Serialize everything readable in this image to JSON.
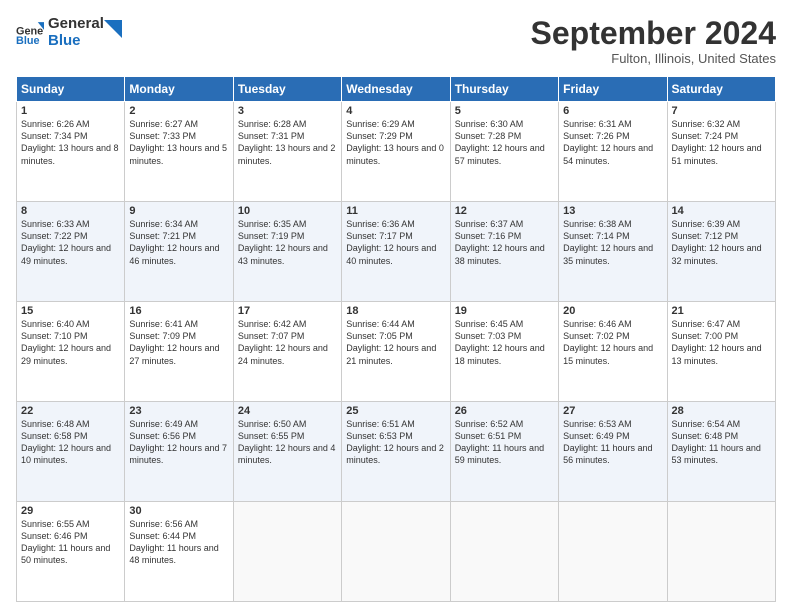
{
  "logo": {
    "line1": "General",
    "line2": "Blue"
  },
  "title": "September 2024",
  "location": "Fulton, Illinois, United States",
  "days_of_week": [
    "Sunday",
    "Monday",
    "Tuesday",
    "Wednesday",
    "Thursday",
    "Friday",
    "Saturday"
  ],
  "weeks": [
    [
      {
        "day": "1",
        "sunrise": "6:26 AM",
        "sunset": "7:34 PM",
        "daylight": "13 hours and 8 minutes."
      },
      {
        "day": "2",
        "sunrise": "6:27 AM",
        "sunset": "7:33 PM",
        "daylight": "13 hours and 5 minutes."
      },
      {
        "day": "3",
        "sunrise": "6:28 AM",
        "sunset": "7:31 PM",
        "daylight": "13 hours and 2 minutes."
      },
      {
        "day": "4",
        "sunrise": "6:29 AM",
        "sunset": "7:29 PM",
        "daylight": "13 hours and 0 minutes."
      },
      {
        "day": "5",
        "sunrise": "6:30 AM",
        "sunset": "7:28 PM",
        "daylight": "12 hours and 57 minutes."
      },
      {
        "day": "6",
        "sunrise": "6:31 AM",
        "sunset": "7:26 PM",
        "daylight": "12 hours and 54 minutes."
      },
      {
        "day": "7",
        "sunrise": "6:32 AM",
        "sunset": "7:24 PM",
        "daylight": "12 hours and 51 minutes."
      }
    ],
    [
      {
        "day": "8",
        "sunrise": "6:33 AM",
        "sunset": "7:22 PM",
        "daylight": "12 hours and 49 minutes."
      },
      {
        "day": "9",
        "sunrise": "6:34 AM",
        "sunset": "7:21 PM",
        "daylight": "12 hours and 46 minutes."
      },
      {
        "day": "10",
        "sunrise": "6:35 AM",
        "sunset": "7:19 PM",
        "daylight": "12 hours and 43 minutes."
      },
      {
        "day": "11",
        "sunrise": "6:36 AM",
        "sunset": "7:17 PM",
        "daylight": "12 hours and 40 minutes."
      },
      {
        "day": "12",
        "sunrise": "6:37 AM",
        "sunset": "7:16 PM",
        "daylight": "12 hours and 38 minutes."
      },
      {
        "day": "13",
        "sunrise": "6:38 AM",
        "sunset": "7:14 PM",
        "daylight": "12 hours and 35 minutes."
      },
      {
        "day": "14",
        "sunrise": "6:39 AM",
        "sunset": "7:12 PM",
        "daylight": "12 hours and 32 minutes."
      }
    ],
    [
      {
        "day": "15",
        "sunrise": "6:40 AM",
        "sunset": "7:10 PM",
        "daylight": "12 hours and 29 minutes."
      },
      {
        "day": "16",
        "sunrise": "6:41 AM",
        "sunset": "7:09 PM",
        "daylight": "12 hours and 27 minutes."
      },
      {
        "day": "17",
        "sunrise": "6:42 AM",
        "sunset": "7:07 PM",
        "daylight": "12 hours and 24 minutes."
      },
      {
        "day": "18",
        "sunrise": "6:44 AM",
        "sunset": "7:05 PM",
        "daylight": "12 hours and 21 minutes."
      },
      {
        "day": "19",
        "sunrise": "6:45 AM",
        "sunset": "7:03 PM",
        "daylight": "12 hours and 18 minutes."
      },
      {
        "day": "20",
        "sunrise": "6:46 AM",
        "sunset": "7:02 PM",
        "daylight": "12 hours and 15 minutes."
      },
      {
        "day": "21",
        "sunrise": "6:47 AM",
        "sunset": "7:00 PM",
        "daylight": "12 hours and 13 minutes."
      }
    ],
    [
      {
        "day": "22",
        "sunrise": "6:48 AM",
        "sunset": "6:58 PM",
        "daylight": "12 hours and 10 minutes."
      },
      {
        "day": "23",
        "sunrise": "6:49 AM",
        "sunset": "6:56 PM",
        "daylight": "12 hours and 7 minutes."
      },
      {
        "day": "24",
        "sunrise": "6:50 AM",
        "sunset": "6:55 PM",
        "daylight": "12 hours and 4 minutes."
      },
      {
        "day": "25",
        "sunrise": "6:51 AM",
        "sunset": "6:53 PM",
        "daylight": "12 hours and 2 minutes."
      },
      {
        "day": "26",
        "sunrise": "6:52 AM",
        "sunset": "6:51 PM",
        "daylight": "11 hours and 59 minutes."
      },
      {
        "day": "27",
        "sunrise": "6:53 AM",
        "sunset": "6:49 PM",
        "daylight": "11 hours and 56 minutes."
      },
      {
        "day": "28",
        "sunrise": "6:54 AM",
        "sunset": "6:48 PM",
        "daylight": "11 hours and 53 minutes."
      }
    ],
    [
      {
        "day": "29",
        "sunrise": "6:55 AM",
        "sunset": "6:46 PM",
        "daylight": "11 hours and 50 minutes."
      },
      {
        "day": "30",
        "sunrise": "6:56 AM",
        "sunset": "6:44 PM",
        "daylight": "11 hours and 48 minutes."
      },
      null,
      null,
      null,
      null,
      null
    ]
  ]
}
